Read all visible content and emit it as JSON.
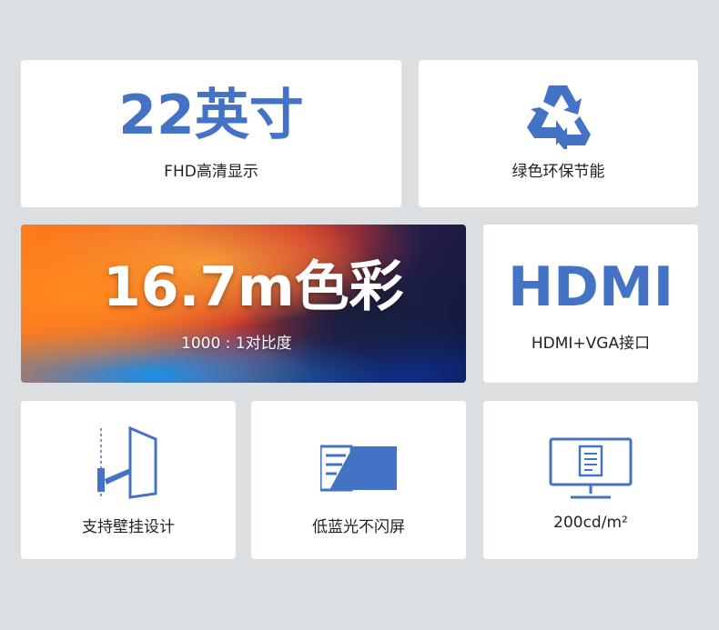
{
  "colors": {
    "accent": "#4472c4",
    "background": "#dcdfe2",
    "card": "#ffffff"
  },
  "cards": {
    "size": {
      "headline": "22英寸",
      "caption": "FHD高清显示"
    },
    "eco": {
      "icon": "recycle-icon",
      "caption": "绿色环保节能"
    },
    "color": {
      "headline": "16.7m色彩",
      "caption": "1000 : 1对比度"
    },
    "hdmi": {
      "headline": "HDMI",
      "caption": "HDMI+VGA接口"
    },
    "wall": {
      "icon": "wall-mount-icon",
      "caption": "支持壁挂设计"
    },
    "bluelight": {
      "icon": "low-blue-light-icon",
      "caption": "低蓝光不闪屏"
    },
    "brightness": {
      "icon": "monitor-document-icon",
      "caption": "200cd/m²"
    }
  }
}
